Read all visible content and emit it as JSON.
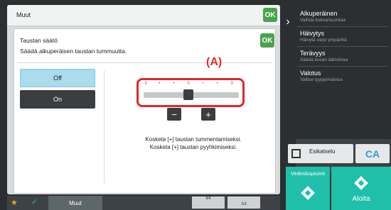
{
  "header": {
    "title": "Muut",
    "ok_label": "OK"
  },
  "dialog": {
    "title": "Taustan säätö",
    "description": "Säädä alkuperäisen taustan tummuutta.",
    "ok_label": "OK",
    "off_label": "Off",
    "on_label": "On",
    "annotation": "(A)",
    "ticks": [
      "-3",
      "•",
      "•",
      "0",
      "•",
      "•",
      "3"
    ],
    "slider_value": 0,
    "slider_range": [
      -3,
      3
    ],
    "minus_label": "−",
    "plus_label": "+",
    "note_line1": "Kosketa [+] taustan tummentamiseksi.",
    "note_line2": "Kosketa [+] taustan pyyhkimiseksi."
  },
  "side_panel": {
    "items": [
      {
        "title": "Alkuperäinen",
        "subtitle": "Vaihda kokoa/suuntaa"
      },
      {
        "title": "Häivytys",
        "subtitle": "Häivytä varjo ympäriltä"
      },
      {
        "title": "Terävyys",
        "subtitle": "Säädä kuvan ääriviivaa"
      },
      {
        "title": "Valotus",
        "subtitle": "Valitse tyyppi/valotus"
      }
    ],
    "preview_label": "Esikatselu",
    "ca_label": "CA",
    "proof_label": "Vedoskopiointi",
    "start_label": "Aloita"
  },
  "bottom_bar": {
    "muut_label": "Muut",
    "values": [
      "B4",
      "A3"
    ]
  },
  "colors": {
    "accent": "#49a34d",
    "highlight": "#e0282a",
    "start": "#20bfa9"
  }
}
